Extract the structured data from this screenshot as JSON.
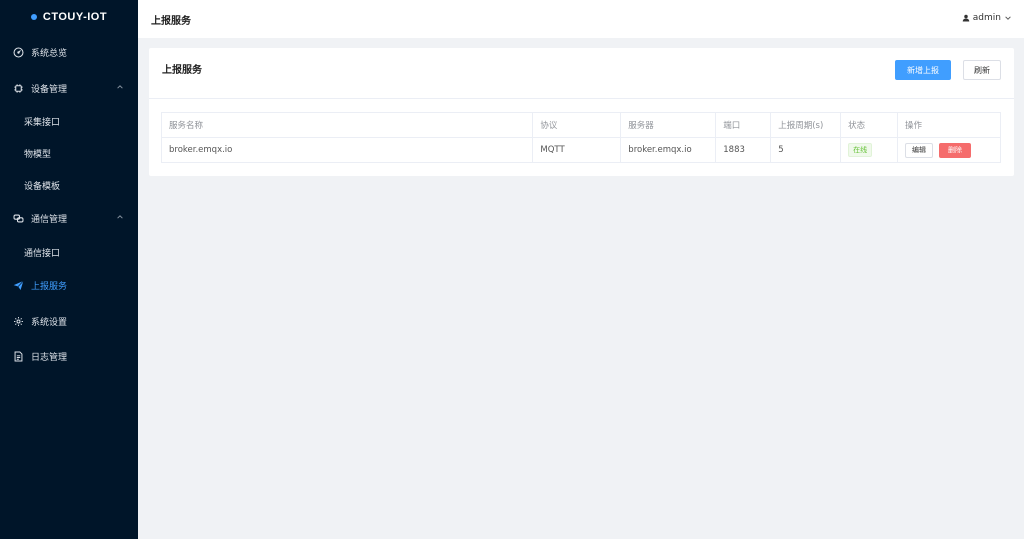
{
  "app": {
    "brand": "CTOUY-IOT"
  },
  "sidebar": {
    "items": [
      {
        "label": "系统总览",
        "icon": "dashboard-icon"
      },
      {
        "label": "设备管理",
        "icon": "chip-icon"
      },
      {
        "label": "采集接口"
      },
      {
        "label": "物模型"
      },
      {
        "label": "设备模板"
      },
      {
        "label": "通信管理",
        "icon": "link-icon"
      },
      {
        "label": "通信接口"
      },
      {
        "label": "上报服务",
        "icon": "send-icon"
      },
      {
        "label": "系统设置",
        "icon": "gear-icon"
      },
      {
        "label": "日志管理",
        "icon": "document-icon"
      }
    ]
  },
  "header": {
    "title": "上报服务",
    "user": "admin"
  },
  "card": {
    "title": "上报服务",
    "add_label": "新增上报",
    "refresh_label": "刷新"
  },
  "table": {
    "columns": [
      "服务名称",
      "协议",
      "服务器",
      "端口",
      "上报周期(s)",
      "状态",
      "操作"
    ],
    "rows": [
      {
        "name": "broker.emqx.io",
        "protocol": "MQTT",
        "server": "broker.emqx.io",
        "port": "1883",
        "period": "5",
        "status": "在线",
        "edit_label": "编辑",
        "delete_label": "删除"
      }
    ]
  },
  "colors": {
    "accent": "#409eff",
    "sidebar_bg": "#001529",
    "danger": "#f56c6c",
    "success": "#67c23a"
  }
}
